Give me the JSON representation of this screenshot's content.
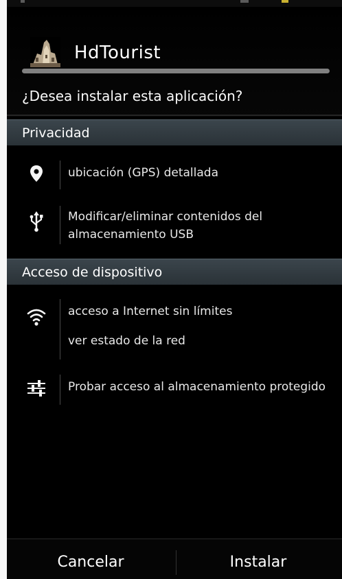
{
  "app": {
    "name": "HdTourist",
    "question": "¿Desea instalar esta aplicación?"
  },
  "sections": [
    {
      "title": "Privacidad",
      "permissions": [
        {
          "icon": "location-pin-icon",
          "lines": [
            "ubicación (GPS) detallada"
          ]
        },
        {
          "icon": "usb-icon",
          "lines": [
            "Modificar/eliminar contenidos del",
            "almacenamiento USB"
          ]
        }
      ]
    },
    {
      "title": "Acceso de dispositivo",
      "permissions": [
        {
          "icon": "wifi-icon",
          "lines": [
            "acceso a Internet sin límites",
            "ver estado de la red"
          ]
        },
        {
          "icon": "settings-sliders-icon",
          "lines": [
            "Probar acceso al almacenamiento protegido"
          ]
        }
      ]
    }
  ],
  "buttons": {
    "cancel": "Cancelar",
    "install": "Instalar"
  }
}
